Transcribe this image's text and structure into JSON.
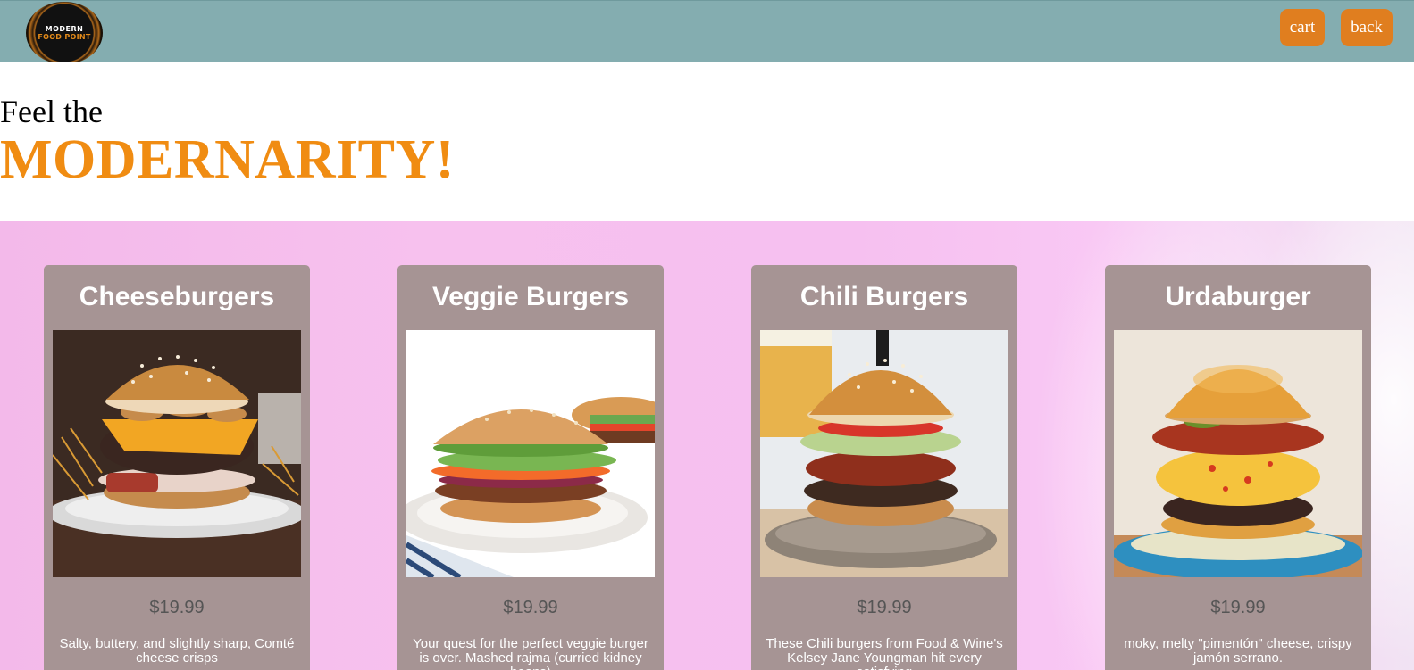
{
  "header": {
    "logo": {
      "line1": "MODERN",
      "line2": "FOOD POINT"
    },
    "cart_label": "cart",
    "back_label": "back"
  },
  "hero": {
    "subtitle": "Feel the",
    "title": "MODERNARITY!"
  },
  "products": [
    {
      "name": "Cheeseburgers",
      "price": "$19.99",
      "description": "Salty, buttery, and slightly sharp, Comté cheese crisps"
    },
    {
      "name": "Veggie Burgers",
      "price": "$19.99",
      "description": "Your quest for the perfect veggie burger is over. Mashed rajma (curried kidney beans)"
    },
    {
      "name": "Chili Burgers",
      "price": "$19.99",
      "description": "These Chili burgers from Food & Wine's Kelsey Jane Youngman hit every satisfying"
    },
    {
      "name": "Urdaburger",
      "price": "$19.99",
      "description": "moky, melty \"pimentón\" cheese, crispy jamón serrano."
    }
  ],
  "colors": {
    "header_bg": "#84adb0",
    "button_bg": "#e07e1f",
    "accent_title": "#f08c12",
    "card_bg": "#a69494"
  }
}
